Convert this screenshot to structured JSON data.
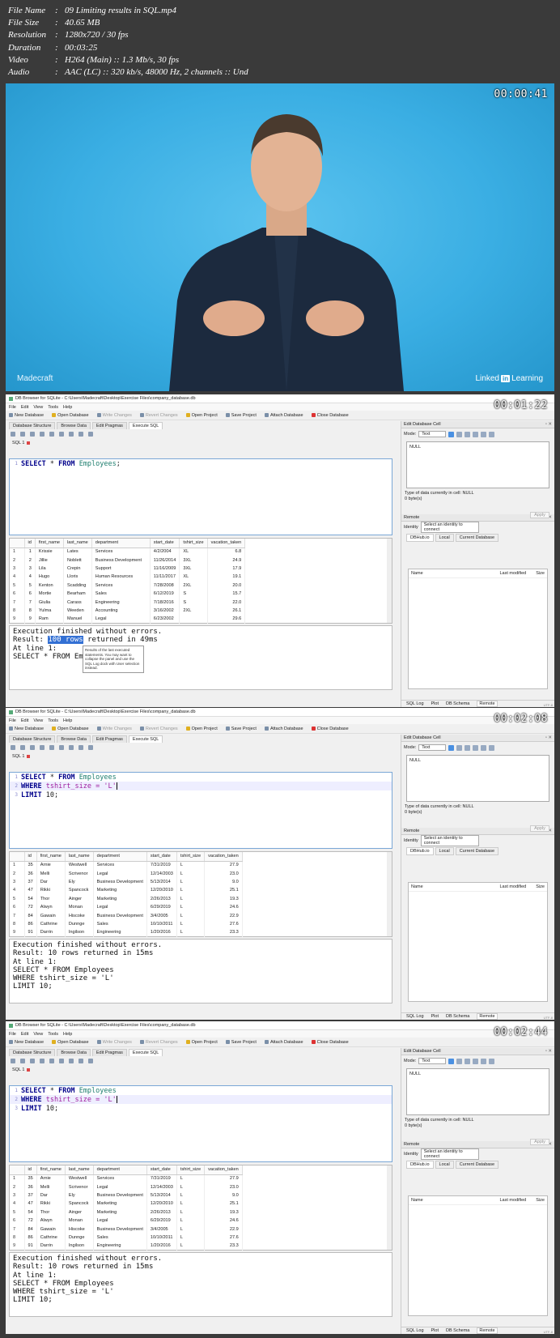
{
  "info": [
    {
      "k": "File Name",
      "v": "09 Limiting results in SQL.mp4"
    },
    {
      "k": "File Size",
      "v": "40.65 MB"
    },
    {
      "k": "Resolution",
      "v": "1280x720 / 30 fps"
    },
    {
      "k": "Duration",
      "v": "00:03:25"
    },
    {
      "k": "Video",
      "v": "H264 (Main) :: 1.3 Mb/s, 30 fps"
    },
    {
      "k": "Audio",
      "v": "AAC (LC) :: 320 kb/s, 48000 Hz, 2 channels :: Und"
    }
  ],
  "frame1": {
    "timestamp": "00:00:41",
    "brand": "Madecraft",
    "linkedin_a": "Linked",
    "linkedin_b": "in",
    "linkedin_c": "Learning"
  },
  "app": {
    "title": "DB Browser for SQLite - C:\\Users\\Madecraft\\Desktop\\Exercise Files\\company_database.db",
    "menu": [
      "File",
      "Edit",
      "View",
      "Tools",
      "Help"
    ],
    "toolbar": [
      "New Database",
      "Open Database",
      "Write Changes",
      "Revert Changes",
      "Open Project",
      "Save Project",
      "Attach Database",
      "Close Database"
    ],
    "tabs": [
      "Database Structure",
      "Browse Data",
      "Edit Pragmas",
      "Execute SQL"
    ],
    "sql_tab": "SQL 1",
    "edit_cell_title": "Edit Database Cell",
    "mode_label": "Mode:",
    "mode_value": "Text",
    "null_text": "NULL",
    "type_info": "Type of data currently in cell: NULL",
    "size_info": "0 byte(s)",
    "apply": "Apply",
    "remote_title": "Remote",
    "identity_label": "Identity",
    "identity_value": "Select an identity to connect",
    "remote_tabs": [
      "DBHub.io",
      "Local",
      "Current Database"
    ],
    "remote_cols": [
      "Name",
      "Last modified",
      "Size"
    ],
    "bottom_tabs": [
      "SQL Log",
      "Plot",
      "DB Schema",
      "Remote"
    ],
    "utf": "UTF-8"
  },
  "frame2": {
    "timestamp": "00:01:22",
    "sql": [
      [
        "SELECT",
        " * ",
        "FROM",
        " ",
        "Employees",
        ";"
      ]
    ],
    "columns": [
      "id",
      "first_name",
      "last_name",
      "department",
      "start_date",
      "tshirt_size",
      "vacation_taken"
    ],
    "rows": [
      [
        "1",
        "1",
        "Krissie",
        "Lates",
        "Services",
        "4/2/2004",
        "XL",
        "6.8"
      ],
      [
        "2",
        "2",
        "Jillie",
        "Noblett",
        "Business Development",
        "11/26/2014",
        "3XL",
        "24.9"
      ],
      [
        "3",
        "3",
        "Lila",
        "Crepin",
        "Support",
        "11/16/2009",
        "3XL",
        "17.9"
      ],
      [
        "4",
        "4",
        "Hugo",
        "Lloris",
        "Human Resources",
        "11/11/2017",
        "XL",
        "19.1"
      ],
      [
        "5",
        "5",
        "Kenton",
        "Scadding",
        "Services",
        "7/28/2008",
        "2XL",
        "20.0"
      ],
      [
        "6",
        "6",
        "Mortie",
        "Bearham",
        "Sales",
        "6/12/2019",
        "S",
        "15.7"
      ],
      [
        "7",
        "7",
        "Giulia",
        "Carass",
        "Engineering",
        "7/18/2016",
        "S",
        "22.0"
      ],
      [
        "8",
        "8",
        "Yulma",
        "Weeden",
        "Accounting",
        "3/16/2002",
        "2XL",
        "26.1"
      ],
      [
        "9",
        "9",
        "Ram",
        "Manuel",
        "Legal",
        "6/23/2002",
        "",
        "29.6"
      ]
    ],
    "out_l1": "Execution finished without errors.",
    "out_l2a": "Result: ",
    "out_l2b": "100 rows",
    "out_l2c": " returned in 49ms",
    "out_l3": "At line 1:",
    "out_l4": "SELECT * FROM Em",
    "tooltip": "Results of the last executed statements. You may want to collapse the panel and use the SQL Log dock with User selection instead."
  },
  "frame3": {
    "timestamp": "00:02:08",
    "l1": [
      "SELECT",
      " * ",
      "FROM",
      " ",
      "Employees"
    ],
    "l2": [
      "WHERE",
      " tshirt_size = ",
      "'L'"
    ],
    "l3": [
      "LIMIT",
      " 10;"
    ],
    "columns": [
      "id",
      "first_name",
      "last_name",
      "department",
      "start_date",
      "tshirt_size",
      "vacation_taken"
    ],
    "rows": [
      [
        "1",
        "35",
        "Arnie",
        "Westwell",
        "Services",
        "7/31/2019",
        "L",
        "27.9"
      ],
      [
        "2",
        "36",
        "Melli",
        "Scrivenor",
        "Legal",
        "12/14/2003",
        "L",
        "23.0"
      ],
      [
        "3",
        "37",
        "Dar",
        "Ely",
        "Business Development",
        "5/13/2014",
        "L",
        "9.0"
      ],
      [
        "4",
        "47",
        "Rikki",
        "Spancock",
        "Marketing",
        "12/20/2010",
        "L",
        "25.1"
      ],
      [
        "5",
        "54",
        "Thor",
        "Ainger",
        "Marketing",
        "2/26/2013",
        "L",
        "19.3"
      ],
      [
        "6",
        "72",
        "Alwyn",
        "Monan",
        "Legal",
        "6/29/2019",
        "L",
        "24.6"
      ],
      [
        "7",
        "84",
        "Gawain",
        "Hiscoke",
        "Business Development",
        "3/4/2005",
        "L",
        "22.9"
      ],
      [
        "8",
        "86",
        "Cathrine",
        "Dunnge",
        "Sales",
        "10/10/2011",
        "L",
        "27.6"
      ],
      [
        "9",
        "91",
        "Darrin",
        "Ingilson",
        "Engineering",
        "1/20/2016",
        "L",
        "23.3"
      ]
    ],
    "out": [
      "Execution finished without errors.",
      "Result: 10 rows returned in 15ms",
      "At line 1:",
      "SELECT * FROM Employees",
      "WHERE tshirt_size = 'L'",
      "LIMIT 10;"
    ]
  },
  "frame4": {
    "timestamp": "00:02:44"
  }
}
